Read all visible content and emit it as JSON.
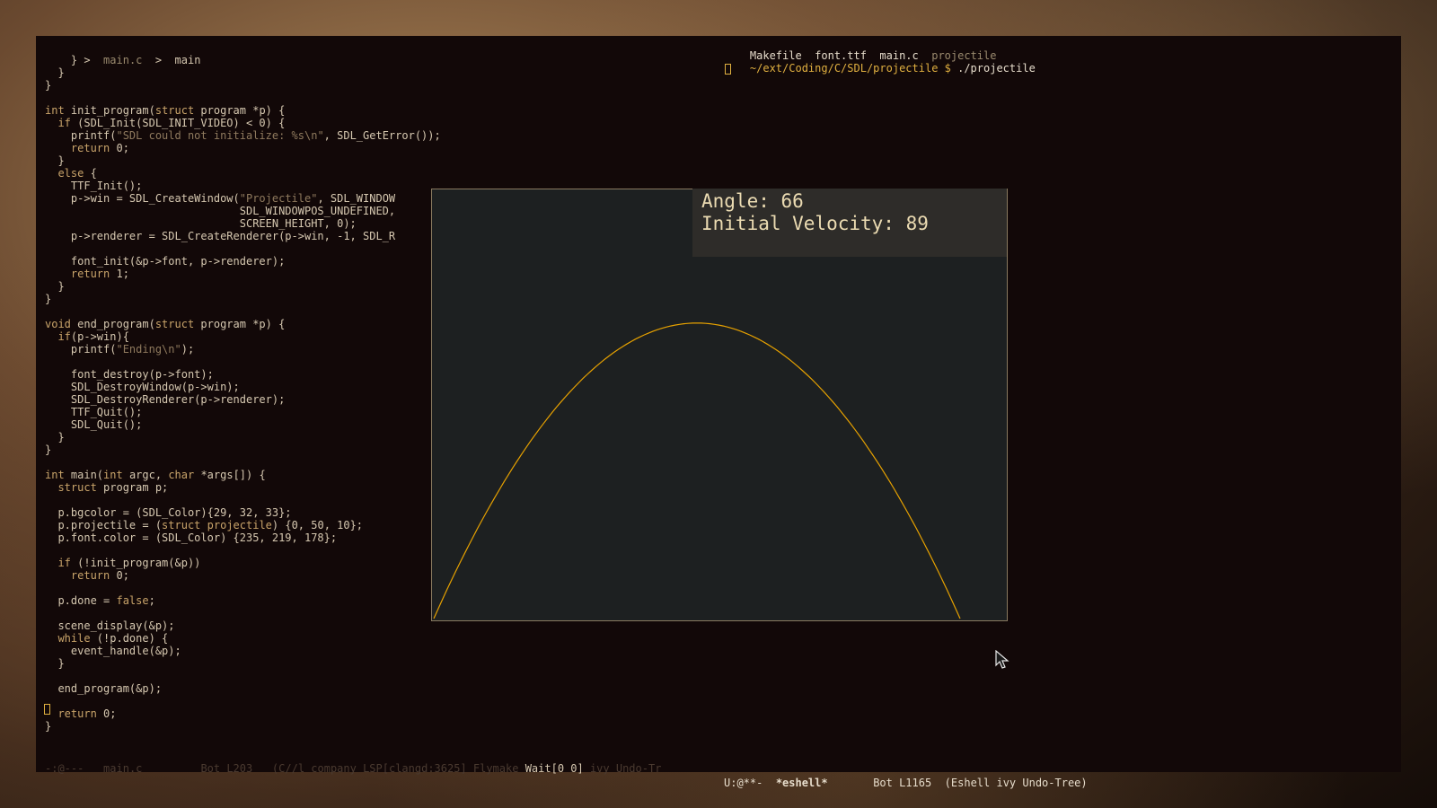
{
  "editor": {
    "breadcrumb": {
      "sep": ">",
      "file": "main.c",
      "symbol": "main"
    },
    "lines": [
      [
        [
          "p",
          "    }"
        ]
      ],
      [
        [
          "p",
          "  }"
        ]
      ],
      [
        [
          "p",
          "}"
        ]
      ],
      [
        [
          "p",
          ""
        ]
      ],
      [
        [
          "k",
          "int"
        ],
        [
          "p",
          " init_program("
        ],
        [
          "k",
          "struct"
        ],
        [
          "p",
          " program *p) {"
        ]
      ],
      [
        [
          "p",
          "  "
        ],
        [
          "k",
          "if"
        ],
        [
          "p",
          " (SDL_Init(SDL_INIT_VIDEO) < 0) {"
        ]
      ],
      [
        [
          "p",
          "    printf("
        ],
        [
          "s",
          "\"SDL could not initialize: %s\\n\""
        ],
        [
          "p",
          ", SDL_GetError());"
        ]
      ],
      [
        [
          "p",
          "    "
        ],
        [
          "k",
          "return"
        ],
        [
          "p",
          " 0;"
        ]
      ],
      [
        [
          "p",
          "  }"
        ]
      ],
      [
        [
          "p",
          "  "
        ],
        [
          "k",
          "else"
        ],
        [
          "p",
          " {"
        ]
      ],
      [
        [
          "p",
          "    TTF_Init();"
        ]
      ],
      [
        [
          "p",
          "    p->win = SDL_CreateWindow("
        ],
        [
          "s",
          "\"Projectile\""
        ],
        [
          "p",
          ", SDL_WINDOW"
        ]
      ],
      [
        [
          "p",
          "                              SDL_WINDOWPOS_UNDEFINED,"
        ]
      ],
      [
        [
          "p",
          "                              SCREEN_HEIGHT, 0);"
        ]
      ],
      [
        [
          "p",
          "    p->renderer = SDL_CreateRenderer(p->win, -1, SDL_R"
        ]
      ],
      [
        [
          "p",
          ""
        ]
      ],
      [
        [
          "p",
          "    font_init(&p->font, p->renderer);"
        ]
      ],
      [
        [
          "p",
          "    "
        ],
        [
          "k",
          "return"
        ],
        [
          "p",
          " 1;"
        ]
      ],
      [
        [
          "p",
          "  }"
        ]
      ],
      [
        [
          "p",
          "}"
        ]
      ],
      [
        [
          "p",
          ""
        ]
      ],
      [
        [
          "k",
          "void"
        ],
        [
          "p",
          " end_program("
        ],
        [
          "k",
          "struct"
        ],
        [
          "p",
          " program *p) {"
        ]
      ],
      [
        [
          "p",
          "  "
        ],
        [
          "k",
          "if"
        ],
        [
          "p",
          "(p->win){"
        ]
      ],
      [
        [
          "p",
          "    printf("
        ],
        [
          "s",
          "\"Ending\\n\""
        ],
        [
          "p",
          ");"
        ]
      ],
      [
        [
          "p",
          ""
        ]
      ],
      [
        [
          "p",
          "    font_destroy(p->font);"
        ]
      ],
      [
        [
          "p",
          "    SDL_DestroyWindow(p->win);"
        ]
      ],
      [
        [
          "p",
          "    SDL_DestroyRenderer(p->renderer);"
        ]
      ],
      [
        [
          "p",
          "    TTF_Quit();"
        ]
      ],
      [
        [
          "p",
          "    SDL_Quit();"
        ]
      ],
      [
        [
          "p",
          "  }"
        ]
      ],
      [
        [
          "p",
          "}"
        ]
      ],
      [
        [
          "p",
          ""
        ]
      ],
      [
        [
          "k",
          "int"
        ],
        [
          "p",
          " main("
        ],
        [
          "k",
          "int"
        ],
        [
          "p",
          " argc, "
        ],
        [
          "k",
          "char"
        ],
        [
          "p",
          " *args[]) {"
        ]
      ],
      [
        [
          "p",
          "  "
        ],
        [
          "k",
          "struct"
        ],
        [
          "p",
          " program p;"
        ]
      ],
      [
        [
          "p",
          ""
        ]
      ],
      [
        [
          "p",
          "  p.bgcolor = (SDL_Color){29, 32, 33};"
        ]
      ],
      [
        [
          "p",
          "  p.projectile = ("
        ],
        [
          "k",
          "struct"
        ],
        [
          "p",
          " "
        ],
        [
          "k",
          "projectile"
        ],
        [
          "p",
          ") {0, 50, 10};"
        ]
      ],
      [
        [
          "p",
          "  p.font.color = (SDL_Color) {235, 219, 178};"
        ]
      ],
      [
        [
          "p",
          ""
        ]
      ],
      [
        [
          "p",
          "  "
        ],
        [
          "k",
          "if"
        ],
        [
          "p",
          " (!init_program(&p))"
        ]
      ],
      [
        [
          "p",
          "    "
        ],
        [
          "k",
          "return"
        ],
        [
          "p",
          " 0;"
        ]
      ],
      [
        [
          "p",
          ""
        ]
      ],
      [
        [
          "p",
          "  p.done = "
        ],
        [
          "k",
          "false"
        ],
        [
          "p",
          ";"
        ]
      ],
      [
        [
          "p",
          ""
        ]
      ],
      [
        [
          "p",
          "  scene_display(&p);"
        ]
      ],
      [
        [
          "p",
          "  "
        ],
        [
          "k",
          "while"
        ],
        [
          "p",
          " (!p.done) {"
        ]
      ],
      [
        [
          "p",
          "    event_handle(&p);"
        ]
      ],
      [
        [
          "p",
          "  }"
        ]
      ],
      [
        [
          "p",
          ""
        ]
      ],
      [
        [
          "p",
          "  end_program(&p);"
        ]
      ],
      [
        [
          "p",
          ""
        ]
      ],
      [
        [
          "p",
          "  "
        ],
        [
          "k",
          "return"
        ],
        [
          "p",
          " 0;"
        ]
      ],
      [
        [
          "p",
          "}"
        ]
      ]
    ]
  },
  "terminal": {
    "ls_files": [
      "Makefile",
      "font.ttf",
      "main.c"
    ],
    "ls_dir": "projectile",
    "prompt_path": "~/ext/Coding/C/SDL/projectile $",
    "command": "./projectile"
  },
  "modeline": {
    "left_state": "-:@---",
    "left_buffer": "main.c",
    "left_pos": "Bot L203",
    "left_modes": "(C//l company LSP[clangd:3625] Flymake",
    "left_wait": "Wait[0 0]",
    "left_tail": " ivy Undo-Tr",
    "right_state": "U:@**-",
    "right_buffer": "*eshell*",
    "right_pos": "Bot L1165",
    "right_modes": "(Eshell ivy Undo-Tree)"
  },
  "sdl": {
    "angle_text": "Angle: 66",
    "velocity_text": "Initial Velocity: 89",
    "trajectory_color": "#e6a100",
    "background_color": "#1d2021",
    "curve_peak_fraction": 0.31
  },
  "colors": {
    "keyword": "#c9a46a",
    "string": "#8f7a5e",
    "text": "#d6c8b0",
    "prompt_path": "#e0b040"
  }
}
